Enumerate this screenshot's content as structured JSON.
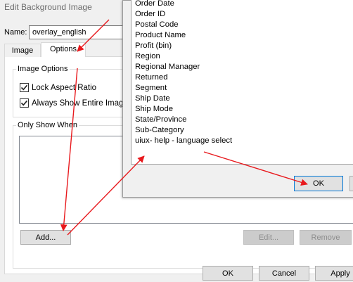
{
  "dialog": {
    "title": "Edit Background Image",
    "name_label": "Name:",
    "name_value": "overlay_english",
    "tabs": [
      {
        "label": "Image",
        "selected": false
      },
      {
        "label": "Options",
        "selected": true
      }
    ],
    "image_options": {
      "legend": "Image Options",
      "lock_aspect_ratio": {
        "label": "Lock Aspect Ratio",
        "checked": true
      },
      "always_show_entire_image": {
        "label": "Always Show Entire Image",
        "checked": true
      }
    },
    "only_show_when": {
      "legend": "Only Show When",
      "add_label": "Add...",
      "edit_label": "Edit...",
      "remove_label": "Remove"
    },
    "footer": {
      "ok_label": "OK",
      "cancel_label": "Cancel",
      "apply_label": "Apply"
    }
  },
  "field_popup": {
    "items": [
      "Order Date",
      "Order ID",
      "Postal Code",
      "Product Name",
      "Profit (bin)",
      "Region",
      "Regional Manager",
      "Returned",
      "Segment",
      "Ship Date",
      "Ship Mode",
      "State/Province",
      "Sub-Category",
      "uiux- help - language select"
    ],
    "ok_label": "OK"
  },
  "colors": {
    "annotation_arrow": "#e8191d",
    "default_button_border": "#0078d7"
  }
}
